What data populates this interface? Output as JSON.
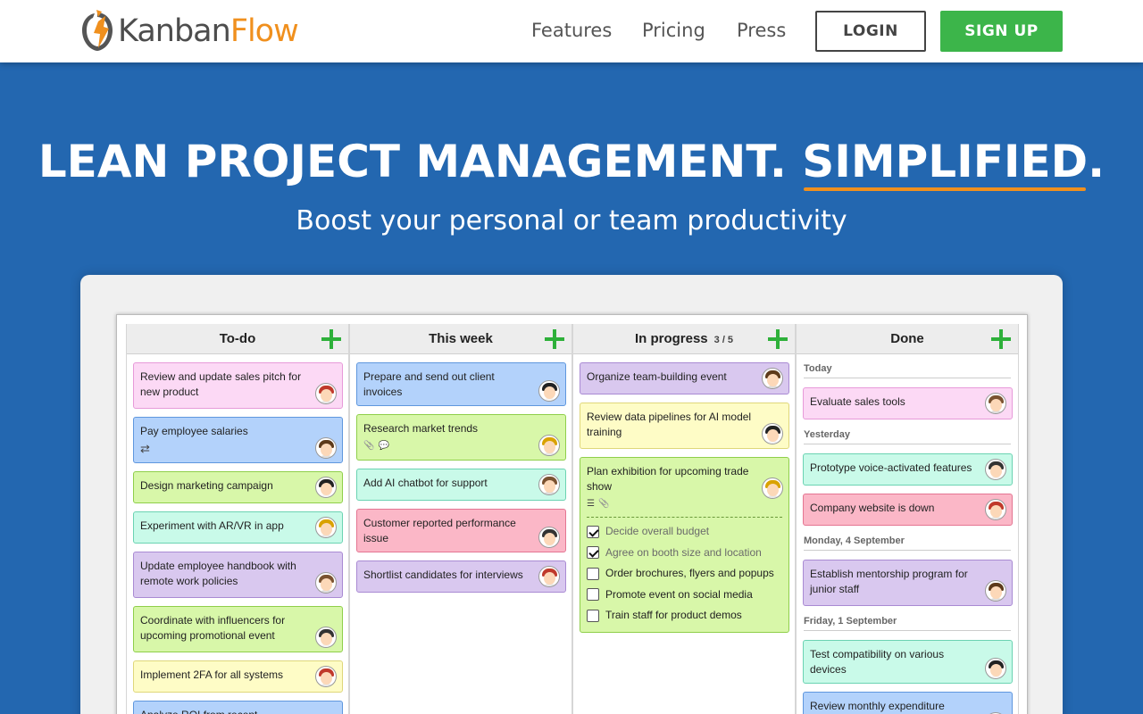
{
  "brand": {
    "part1": "Kanban",
    "part2": "Flow",
    "accent": "#f0901e"
  },
  "nav": {
    "features": "Features",
    "pricing": "Pricing",
    "press": "Press",
    "login": "LOGIN",
    "signup": "SIGN UP"
  },
  "hero": {
    "title_prefix": "LEAN PROJECT MANAGEMENT. ",
    "title_strong": "SIMPLIFIED",
    "title_suffix": ".",
    "subtitle": "Boost your personal or team productivity"
  },
  "board": {
    "columns": [
      {
        "title": "To-do",
        "tasks": [
          {
            "text": "Review and update sales pitch for new product",
            "color": "pink"
          },
          {
            "text": "Pay employee salaries",
            "color": "blue",
            "icons": [
              "repeat-icon"
            ]
          },
          {
            "text": "Design marketing campaign",
            "color": "lime"
          },
          {
            "text": "Experiment with AR/VR in app",
            "color": "mint"
          },
          {
            "text": "Update employee handbook with remote work policies",
            "color": "purple"
          },
          {
            "text": "Coordinate with influencers for upcoming promotional event",
            "color": "lime"
          },
          {
            "text": "Implement 2FA for all systems",
            "color": "yellow"
          },
          {
            "text": "Analyze ROI from recent investments",
            "color": "blue"
          }
        ]
      },
      {
        "title": "This week",
        "tasks": [
          {
            "text": "Prepare and send out client invoices",
            "color": "blue"
          },
          {
            "text": "Research market trends",
            "color": "lime",
            "icons": [
              "paperclip-icon",
              "comment-icon"
            ]
          },
          {
            "text": "Add AI chatbot for support",
            "color": "mint"
          },
          {
            "text": "Customer reported performance issue",
            "color": "rose"
          },
          {
            "text": "Shortlist candidates for interviews",
            "color": "purple"
          }
        ]
      },
      {
        "title": "In progress",
        "wip": "3 / 5",
        "tasks": [
          {
            "text": "Organize team-building event",
            "color": "purple"
          },
          {
            "text": "Review data pipelines for AI model training",
            "color": "yellow"
          },
          {
            "text": "Plan exhibition for upcoming trade show",
            "color": "lime",
            "icons": [
              "checklist-icon",
              "paperclip-icon"
            ],
            "subtasks": [
              {
                "text": "Decide overall budget",
                "done": true
              },
              {
                "text": "Agree on booth size and location",
                "done": true
              },
              {
                "text": "Order brochures, flyers and popups",
                "done": false
              },
              {
                "text": "Promote event on social media",
                "done": false
              },
              {
                "text": "Train staff for product demos",
                "done": false
              }
            ]
          }
        ]
      },
      {
        "title": "Done",
        "groups": [
          {
            "label": "Today",
            "tasks": [
              {
                "text": "Evaluate sales tools",
                "color": "pink"
              }
            ]
          },
          {
            "label": "Yesterday",
            "tasks": [
              {
                "text": "Prototype voice-activated features",
                "color": "mint"
              },
              {
                "text": "Company website is down",
                "color": "rose"
              }
            ]
          },
          {
            "label": "Monday, 4 September",
            "tasks": [
              {
                "text": "Establish mentorship program for junior staff",
                "color": "purple"
              }
            ]
          },
          {
            "label": "Friday, 1 September",
            "tasks": [
              {
                "text": "Test compatibility on various devices",
                "color": "mint"
              },
              {
                "text": "Review monthly expenditure against budget",
                "color": "blue"
              }
            ]
          }
        ]
      }
    ]
  }
}
